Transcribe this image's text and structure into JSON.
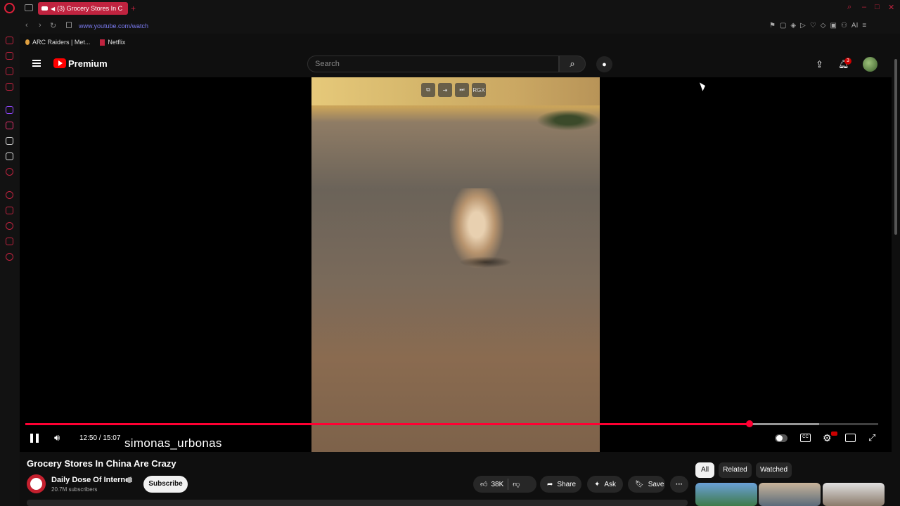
{
  "browser": {
    "tab_title": "(3) Grocery Stores In C",
    "new_tab": "+",
    "url": "www.youtube.com/watch",
    "bookmarks": [
      "ARC Raiders | Met...",
      "Netflix"
    ],
    "extensions_label": "AI"
  },
  "youtube": {
    "logo_label": "Premium",
    "search_placeholder": "Search",
    "notification_count": "3"
  },
  "player": {
    "overlay_label": "RGX",
    "current_time": "12:50",
    "duration": "15:07",
    "time_display": "12:50 / 15:07",
    "progress_fraction": 0.8489,
    "buffer_fraction": 0.9308,
    "watermark": "simonas_urbonas",
    "cc_label": "CC"
  },
  "video": {
    "title": "Grocery Stores In China Are Crazy",
    "channel": "Daily Dose Of Internet",
    "subscribers": "20.7M subscribers",
    "subscribe_label": "Subscribe",
    "likes": "38K",
    "share_label": "Share",
    "ask_label": "Ask",
    "save_label": "Save"
  },
  "chips": [
    "All",
    "Related",
    "Watched"
  ],
  "colors": {
    "accent": "#ff0033",
    "browser_accent": "#c0233f",
    "background": "#0f0f0f"
  }
}
